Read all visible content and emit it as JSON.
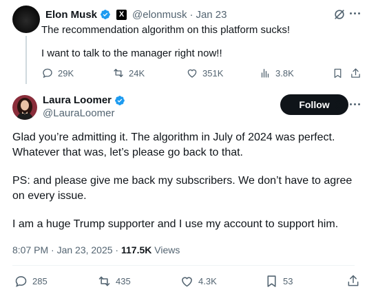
{
  "original_post": {
    "author_name": "Elon Musk",
    "handle": "@elonmusk",
    "separator": "·",
    "date": "Jan 23",
    "line1": "The recommendation algorithm on this platform sucks!",
    "line2": "I want to talk to the manager right now!!",
    "badge_letter": "X",
    "stats": {
      "replies": "29K",
      "reposts": "24K",
      "likes": "351K",
      "views": "3.8K"
    }
  },
  "reply_post": {
    "author_name": "Laura Loomer",
    "handle": "@LauraLoomer",
    "follow_label": "Follow",
    "paragraph1": "Glad you’re admitting it. The algorithm in July of 2024 was perfect. Whatever that was, let’s please go back to that.",
    "paragraph2": "PS: and please give me back my subscribers. We don’t have to agree on every issue.",
    "paragraph3": "I am a huge Trump supporter and I use my account to support him.",
    "timestamp": "8:07 PM · Jan 23, 2025 · ",
    "view_count": "117.5K",
    "views_label": "Views",
    "stats": {
      "replies": "285",
      "reposts": "435",
      "likes": "4.3K",
      "bookmarks": "53"
    }
  },
  "colors": {
    "verified_blue": "#1d9bf0",
    "muted": "#536471",
    "text": "#0f1419",
    "divider": "#eff3f4"
  },
  "icons": {
    "more": "more-icon",
    "grok": "grok-icon",
    "reply": "reply-icon",
    "repost": "repost-icon",
    "like": "like-icon",
    "views": "views-icon",
    "bookmark": "bookmark-icon",
    "share": "share-icon"
  }
}
